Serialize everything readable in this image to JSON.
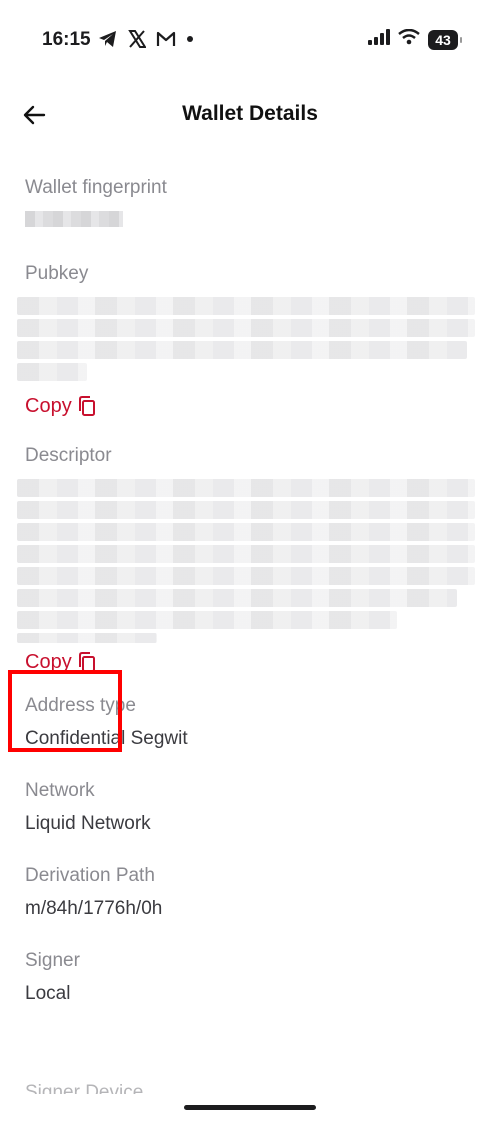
{
  "status_bar": {
    "time": "16:15",
    "battery": "43",
    "app_icons": [
      "telegram-icon",
      "x-icon",
      "gmail-icon",
      "dot-icon"
    ]
  },
  "header": {
    "title": "Wallet Details",
    "back_icon": "arrow-left-icon"
  },
  "fields": {
    "fingerprint": {
      "label": "Wallet fingerprint"
    },
    "pubkey": {
      "label": "Pubkey",
      "copy_label": "Copy"
    },
    "descriptor": {
      "label": "Descriptor",
      "copy_label": "Copy"
    },
    "address_type": {
      "label": "Address type",
      "value": "Confidential Segwit"
    },
    "network": {
      "label": "Network",
      "value": "Liquid Network"
    },
    "derivation": {
      "label": "Derivation Path",
      "value": "m/84h/1776h/0h"
    },
    "signer": {
      "label": "Signer",
      "value": "Local"
    },
    "signer_device": {
      "label": "Signer Device"
    }
  },
  "colors": {
    "accent": "#c8102e",
    "highlight": "#ff0000",
    "label": "#8a8a90",
    "value": "#3b3b40"
  }
}
